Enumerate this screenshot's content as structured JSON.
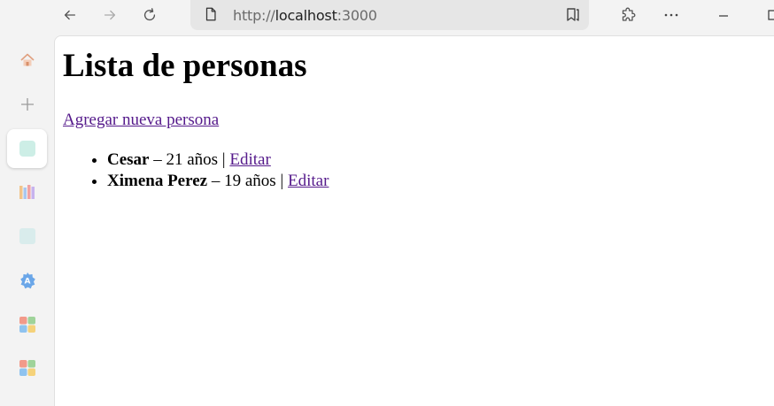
{
  "browser": {
    "url_prefix": "http://",
    "url_host": "localhost",
    "url_port": ":3000"
  },
  "page": {
    "title": "Lista de personas",
    "add_link": "Agregar nueva persona",
    "people": [
      {
        "name": "Cesar",
        "detail": " – 21 años | ",
        "edit": "Editar"
      },
      {
        "name": "Ximena Perez",
        "detail": " – 19 años | ",
        "edit": "Editar"
      }
    ]
  },
  "colors": {
    "visited_link": "#551a8b",
    "chrome_bg": "#f3f3f3",
    "address_bg": "#e6e6e6"
  },
  "icons": {
    "back": "arrow-left-icon",
    "forward": "arrow-right-icon",
    "reload": "reload-icon",
    "page_info": "page-icon",
    "reader": "reading-view-icon",
    "extensions": "puzzle-icon",
    "more": "more-dots-icon",
    "minimize": "minimize-icon",
    "maximize": "maximize-icon",
    "sidebar": [
      "home-icon",
      "add-icon",
      "tab-icon",
      "books-icon",
      "tab-icon",
      "translator-icon",
      "office-icon",
      "office-icon"
    ]
  }
}
